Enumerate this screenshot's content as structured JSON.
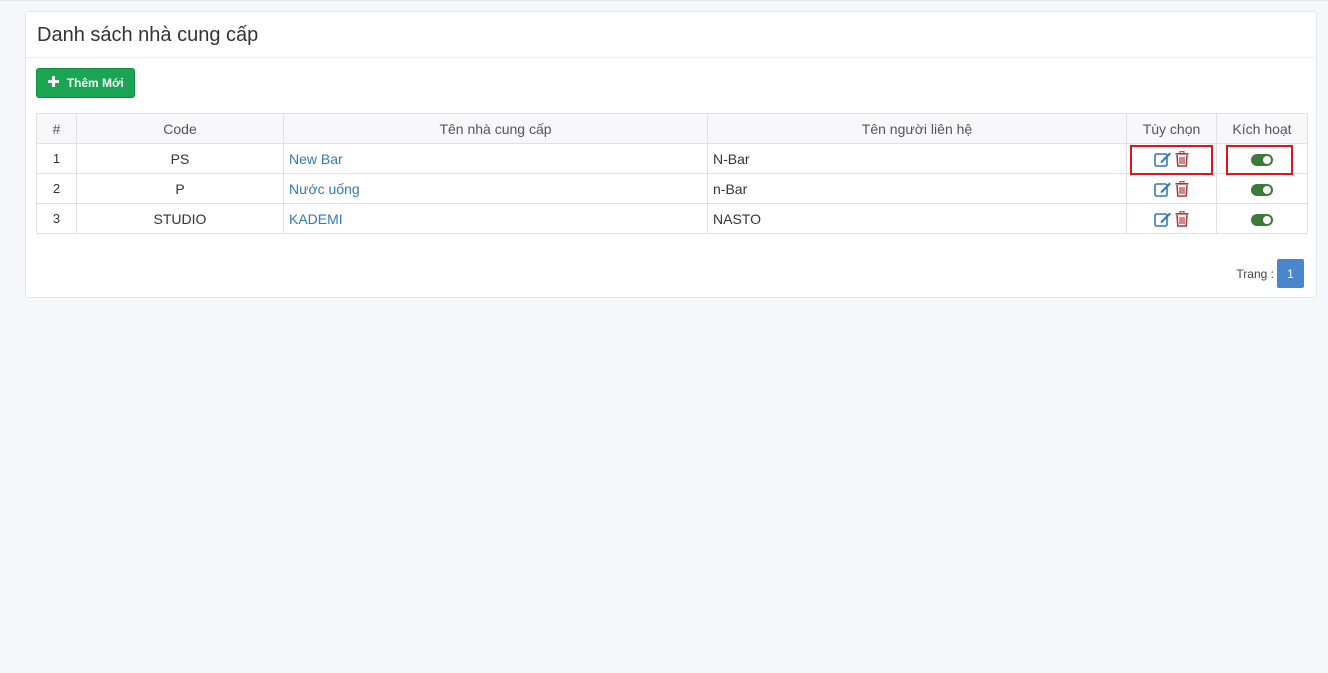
{
  "page": {
    "title": "Danh sách nhà cung cấp"
  },
  "toolbar": {
    "add_label": "Thêm Mới",
    "add_icon": "plus-icon"
  },
  "table": {
    "headers": [
      "#",
      "Code",
      "Tên nhà cung cấp",
      "Tên người liên hệ",
      "Tùy chọn",
      "Kích hoạt"
    ],
    "rows": [
      {
        "index": "1",
        "code": "PS",
        "name": "New Bar",
        "contact": "N-Bar",
        "active": true
      },
      {
        "index": "2",
        "code": "P",
        "name": "Nước uống",
        "contact": "n-Bar",
        "active": true
      },
      {
        "index": "3",
        "code": "STUDIO",
        "name": "KADEMI",
        "contact": "NASTO",
        "active": true
      }
    ],
    "option_icons": [
      "edit-icon",
      "trash-icon"
    ]
  },
  "pagination": {
    "label": "Trang :",
    "pages": [
      "1"
    ],
    "current": "1"
  },
  "colors": {
    "primary_button": "#1aa552",
    "link": "#337ab7",
    "edit_icon": "#337ab7",
    "delete_icon": "#b0343b",
    "toggle_on": "#3c7a3c",
    "highlight": "#e0141e",
    "page_active": "#4a86cc"
  }
}
